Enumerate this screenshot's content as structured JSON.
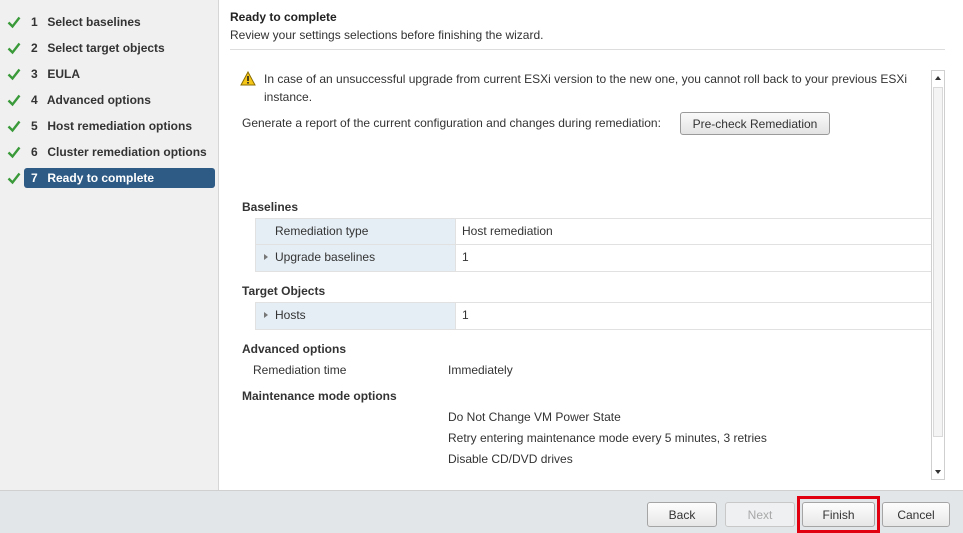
{
  "sidebar": {
    "steps": [
      {
        "num": "1",
        "label": "Select baselines",
        "done": true
      },
      {
        "num": "2",
        "label": "Select target objects",
        "done": true
      },
      {
        "num": "3",
        "label": "EULA",
        "done": true
      },
      {
        "num": "4",
        "label": "Advanced options",
        "done": true
      },
      {
        "num": "5",
        "label": "Host remediation options",
        "done": true
      },
      {
        "num": "6",
        "label": "Cluster remediation options",
        "done": true
      },
      {
        "num": "7",
        "label": "Ready to complete",
        "done": true,
        "active": true
      }
    ],
    "check_color": "#3a9a3a",
    "active_color": "#2e5b85"
  },
  "header": {
    "title": "Ready to complete",
    "subtitle": "Review your settings selections before finishing the wizard."
  },
  "content": {
    "warning_icon": "warning-icon",
    "warning_text": "In case of an unsuccessful upgrade from current ESXi version to the new one, you cannot roll back to your previous ESXi instance.",
    "report_text": "Generate a report of the current configuration and changes during remediation:",
    "precheck_label": "Pre-check Remediation",
    "baselines": {
      "title": "Baselines",
      "rows": [
        {
          "label": "Remediation type",
          "value": "Host remediation",
          "expandable": false
        },
        {
          "label": "Upgrade baselines",
          "value": "1",
          "expandable": true
        }
      ]
    },
    "target_objects": {
      "title": "Target Objects",
      "rows": [
        {
          "label": "Hosts",
          "value": "1",
          "expandable": true
        }
      ]
    },
    "advanced_options": {
      "title": "Advanced options",
      "remediation_time_label": "Remediation time",
      "remediation_time_value": "Immediately"
    },
    "maintenance_mode": {
      "title": "Maintenance mode options",
      "values": [
        "Do Not Change VM Power State",
        "Retry entering maintenance mode every 5 minutes, 3 retries",
        "Disable CD/DVD drives"
      ]
    }
  },
  "footer": {
    "back_label": "Back",
    "next_label": "Next",
    "finish_label": "Finish",
    "cancel_label": "Cancel",
    "highlight_color": "#e0000f"
  }
}
